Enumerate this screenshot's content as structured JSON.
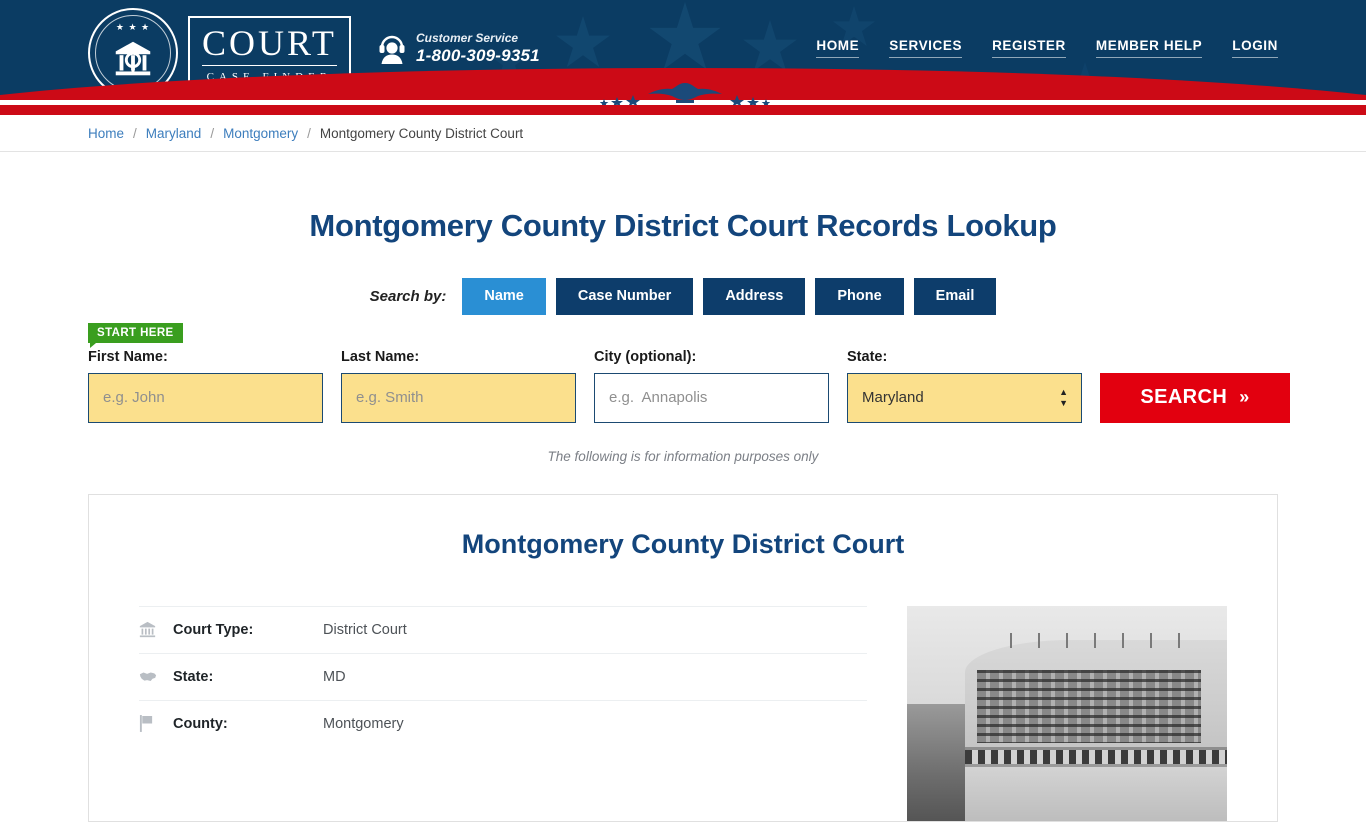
{
  "header": {
    "logo": {
      "brand_main": "COURT",
      "brand_sub": "CASE FINDER",
      "seal_stars": "★ ★ ★",
      "seal_icon": "courthouse-scales-seal"
    },
    "customer_service": {
      "label": "Customer Service",
      "phone": "1-800-309-9351",
      "icon": "headset-support-icon"
    },
    "nav": [
      {
        "label": "HOME"
      },
      {
        "label": "SERVICES"
      },
      {
        "label": "REGISTER"
      },
      {
        "label": "MEMBER HELP"
      },
      {
        "label": "LOGIN"
      }
    ],
    "colors": {
      "navy": "#0b3c63",
      "red": "#cc0a16",
      "star_watermark": "#18507a"
    }
  },
  "breadcrumb": {
    "items": [
      {
        "label": "Home",
        "link": true
      },
      {
        "label": "Maryland",
        "link": true
      },
      {
        "label": "Montgomery",
        "link": true
      },
      {
        "label": "Montgomery County District Court",
        "link": false
      }
    ],
    "separator": "/"
  },
  "main": {
    "page_title": "Montgomery County District Court Records Lookup",
    "search_by_label": "Search by:",
    "tabs": [
      {
        "label": "Name",
        "active": true
      },
      {
        "label": "Case Number",
        "active": false
      },
      {
        "label": "Address",
        "active": false
      },
      {
        "label": "Phone",
        "active": false
      },
      {
        "label": "Email",
        "active": false
      }
    ],
    "start_badge": "START HERE",
    "form": {
      "first_name": {
        "label": "First Name:",
        "placeholder": "e.g. John",
        "value": ""
      },
      "last_name": {
        "label": "Last Name:",
        "placeholder": "e.g. Smith",
        "value": ""
      },
      "city": {
        "label": "City (optional):",
        "placeholder": "e.g.  Annapolis",
        "value": ""
      },
      "state": {
        "label": "State:",
        "selected": "Maryland"
      },
      "search_button": "SEARCH",
      "search_button_chevron": "»"
    },
    "disclaimer": "The following is for information purposes only"
  },
  "card": {
    "title": "Montgomery County District Court",
    "rows": [
      {
        "icon": "courthouse-icon",
        "label": "Court Type:",
        "value": "District Court"
      },
      {
        "icon": "us-map-icon",
        "label": "State:",
        "value": "MD"
      },
      {
        "icon": "flag-icon",
        "label": "County:",
        "value": "Montgomery"
      }
    ],
    "photo_alt": "courthouse-building-photo"
  },
  "colors": {
    "heading_navy": "#13457c",
    "tab_active": "#2a8fd4",
    "tab_inactive": "#0d3d6b",
    "search_red": "#e2000f",
    "field_yellow": "#fbe08d",
    "badge_green": "#3a9e1f"
  }
}
